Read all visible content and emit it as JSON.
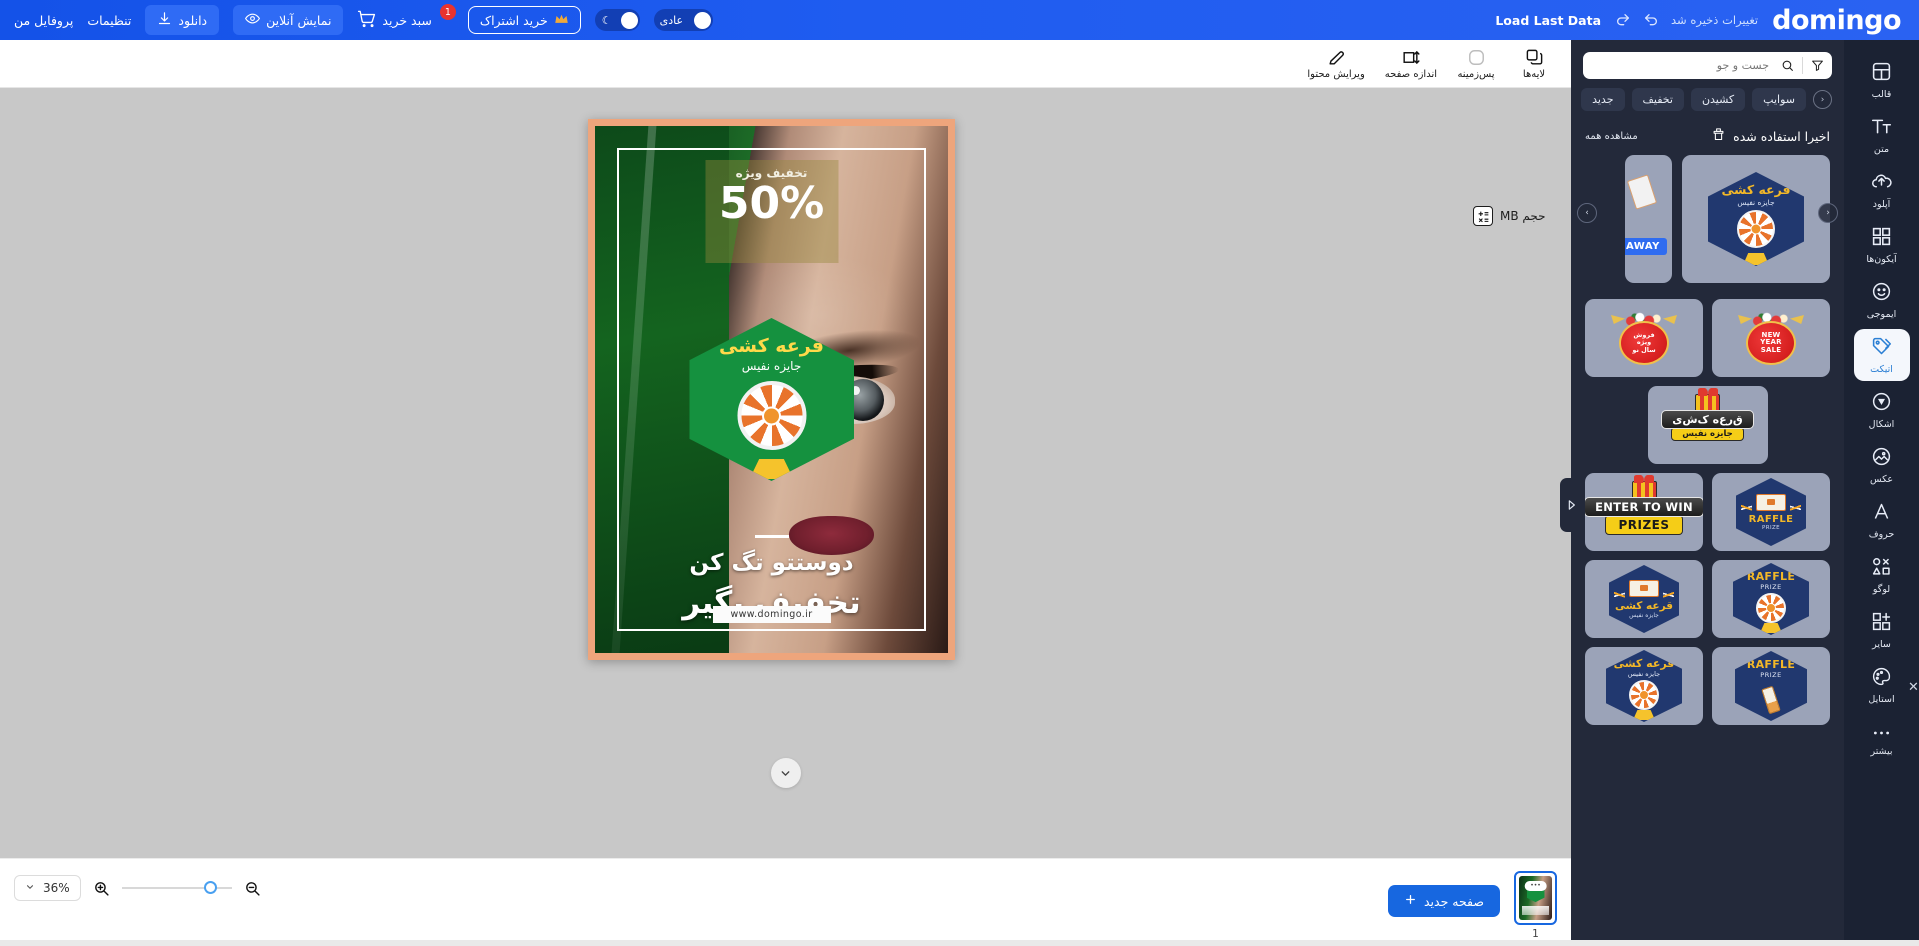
{
  "topbar": {
    "logo": "domingo",
    "saved_note": "تغییرات ذخیره شد",
    "load_last_data": "Load Last Data",
    "profile": "پروفایل من",
    "settings": "تنظیمات",
    "download": "دانلود",
    "online_preview": "نمایش آنلاین",
    "cart_label": "سبد خرید",
    "cart_count": "1",
    "subscription": "خرید اشتراک",
    "mode_label": "عادی",
    "accent_color": "#1f5cf0",
    "cart_badge_color": "#e8332f"
  },
  "toolbar": {
    "items": [
      {
        "label": "ویرایش محتوا",
        "icon": "pencil-icon"
      },
      {
        "label": "اندازه صفحه",
        "icon": "resize-icon"
      },
      {
        "label": "پس‌زمینه",
        "icon": "background-icon"
      },
      {
        "label": "لایه‌ها",
        "icon": "layers-icon"
      }
    ]
  },
  "canvas": {
    "size_badge": "حجم MB",
    "poster": {
      "discount_label": "تخفیف ویژه",
      "discount_value": "50%",
      "badge_title": "قرعه کشی",
      "badge_subtitle": "جایزه نفیس",
      "headline_1": "دوستتو تگ کن",
      "headline_2": "تخفیف بگیر",
      "website": "www.domingo.ir"
    }
  },
  "bottombar": {
    "zoom_value": "36%",
    "new_page": "صفحه جدید",
    "page_number": "1"
  },
  "panel": {
    "search_placeholder": "جست و جو",
    "search_value": "",
    "chips": [
      "جدید",
      "تخفیف",
      "کشیدن",
      "سوایپ"
    ],
    "section_title": "اخیرا استفاده شده",
    "section_all": "مشاهده همه",
    "recent": [
      {
        "title": "قرعه کشی",
        "subtitle": "جایزه نفیس",
        "type": "hex-wheel"
      },
      {
        "title": "AWAY",
        "subtitle": "",
        "type": "tag-away"
      }
    ],
    "stickers": [
      {
        "name": "new-year-sale-en",
        "line1": "NEW",
        "line2": "YEAR",
        "line3": "SALE",
        "type": "ny-en"
      },
      {
        "name": "new-year-sale-fa",
        "line1": "فروش",
        "line2": "ویژه",
        "line3": "سال نو",
        "type": "ny-fa"
      },
      {
        "name": "gift-raffle-plate",
        "title": "ق‌ر‌ع‌ه ک‌ش‌ی",
        "subtitle": "جایزه نفیس",
        "type": "gift-plate"
      },
      {
        "name": "raffle-prize-hex-en",
        "title": "RAFFLE",
        "subtitle": "PRIZE",
        "type": "hex-ticket-en"
      },
      {
        "name": "enter-to-win-prizes",
        "title": "ENTER TO WIN",
        "subtitle": "PRIZES",
        "type": "gift-plate-en"
      },
      {
        "name": "raffle-prize-wheel-en",
        "title": "RAFFLE",
        "subtitle": "PRIZE",
        "type": "hex-wheel-en"
      },
      {
        "name": "raffle-ticket-hex-fa",
        "title": "قرعه کشی",
        "subtitle": "جایزه نفیس",
        "type": "hex-ticket-fa"
      },
      {
        "name": "raffle-prize-hand-en",
        "title": "RAFFLE",
        "subtitle": "PRIZE",
        "type": "hex-hand-en"
      },
      {
        "name": "raffle-wheel-hex-fa",
        "title": "قرعه کشی",
        "subtitle": "جایزه نفیس",
        "type": "hex-wheel-fa"
      }
    ]
  },
  "rail": {
    "items": [
      {
        "label": "قالب",
        "icon": "template-icon",
        "active": false
      },
      {
        "label": "متن",
        "icon": "text-icon",
        "active": false
      },
      {
        "label": "آپلود",
        "icon": "upload-icon",
        "active": false
      },
      {
        "label": "آیکون‌ها",
        "icon": "grid-icon",
        "active": false
      },
      {
        "label": "ایموجی",
        "icon": "emoji-icon",
        "active": false
      },
      {
        "label": "اتیکت",
        "icon": "tag-icon",
        "active": true
      },
      {
        "label": "اشکال",
        "icon": "shapes-icon",
        "active": false
      },
      {
        "label": "عکس",
        "icon": "image-icon",
        "active": false
      },
      {
        "label": "حروف",
        "icon": "letter-icon",
        "active": false
      },
      {
        "label": "لوگو",
        "icon": "logo-icon",
        "active": false
      },
      {
        "label": "سایر",
        "icon": "other-icon",
        "active": false
      },
      {
        "label": "استایل",
        "icon": "palette-icon",
        "active": false
      },
      {
        "label": "بیشتر",
        "icon": "more-icon",
        "active": false
      }
    ]
  }
}
